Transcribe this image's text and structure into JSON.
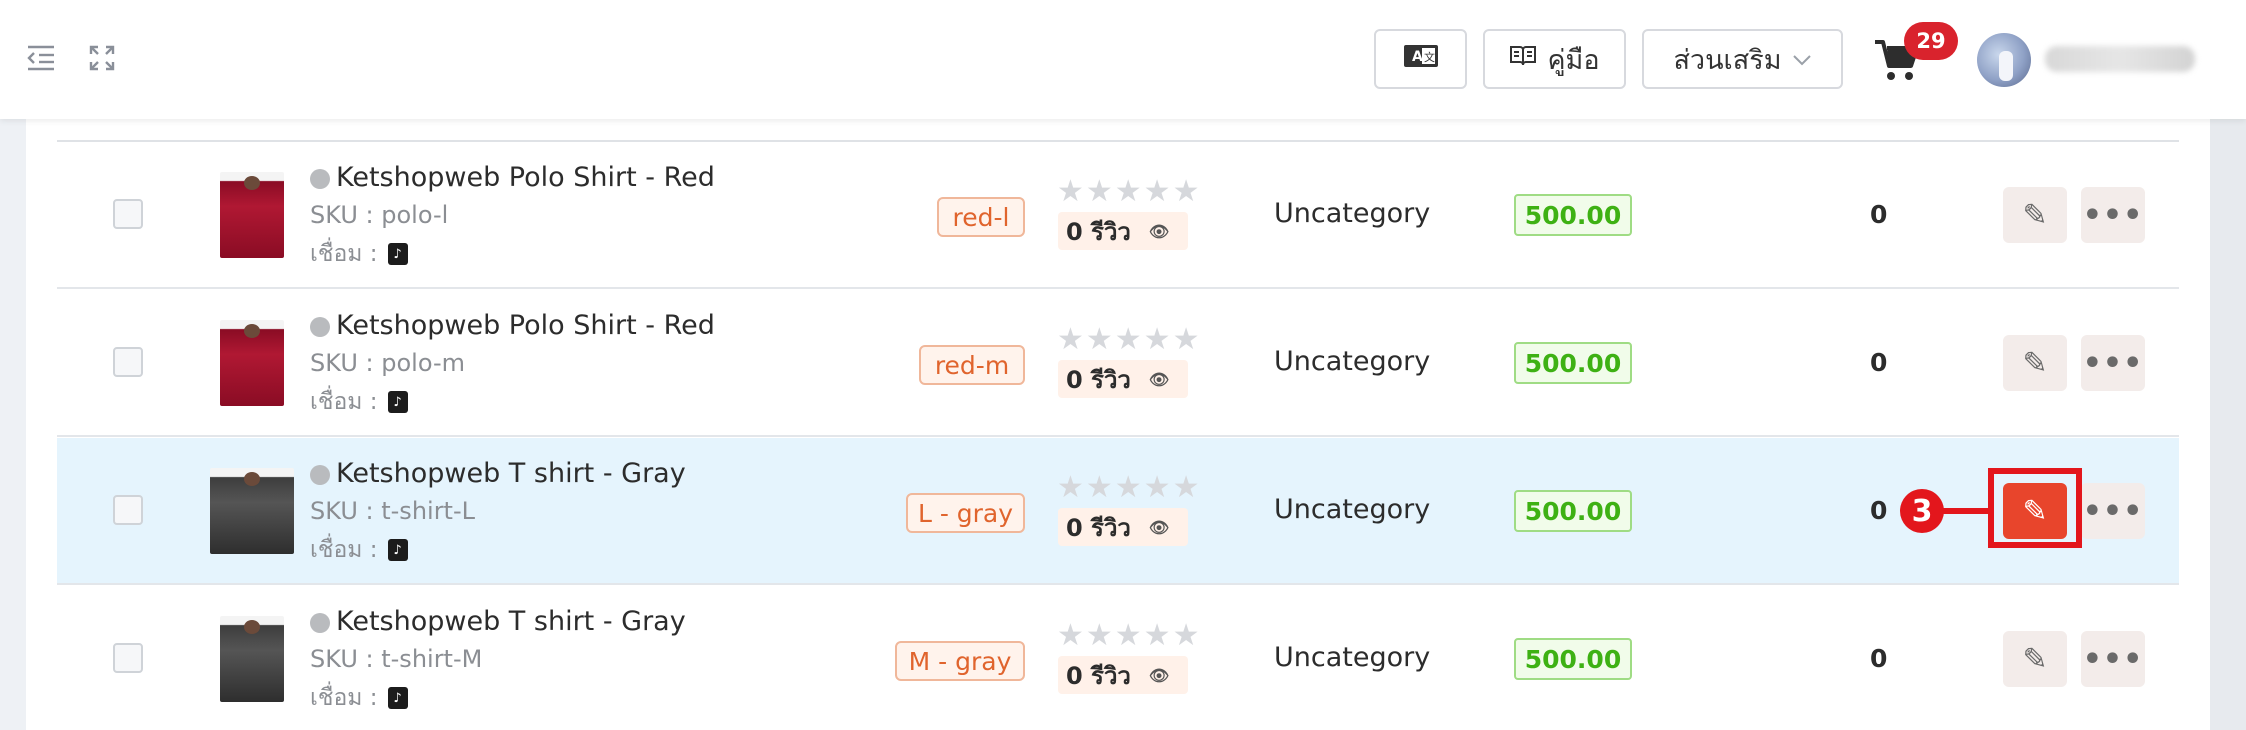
{
  "topbar": {
    "menu_icon": "outdent-menu-icon",
    "expand_icon": "fullscreen-expand-icon",
    "translate_icon": "translate-icon",
    "manual_icon": "book-icon",
    "manual_label": "คู่มือ",
    "addons_label": "ส่วนเสริม",
    "cart_icon": "shopping-cart-icon",
    "cart_count": "29"
  },
  "products": [
    {
      "name": "Ketshopweb Polo Shirt - Red",
      "sku": "SKU : polo-l",
      "link_label": "เชื่อม :",
      "variant": "red-l",
      "reviews": "0 รีวิว",
      "category": "Uncategory",
      "price": "500.00",
      "stock": "0",
      "thumb_color": "red"
    },
    {
      "name": "Ketshopweb Polo Shirt - Red",
      "sku": "SKU : polo-m",
      "link_label": "เชื่อม :",
      "variant": "red-m",
      "reviews": "0 รีวิว",
      "category": "Uncategory",
      "price": "500.00",
      "stock": "0",
      "thumb_color": "red"
    },
    {
      "name": "Ketshopweb T shirt - Gray",
      "sku": "SKU : t-shirt-L",
      "link_label": "เชื่อม :",
      "variant": "L - gray",
      "reviews": "0 รีวิว",
      "category": "Uncategory",
      "price": "500.00",
      "stock": "0",
      "thumb_color": "gray"
    },
    {
      "name": "Ketshopweb T shirt - Gray",
      "sku": "SKU : t-shirt-M",
      "link_label": "เชื่อม :",
      "variant": "M - gray",
      "reviews": "0 รีวิว",
      "category": "Uncategory",
      "price": "500.00",
      "stock": "0",
      "thumb_color": "gray"
    }
  ],
  "callout": {
    "number": "3",
    "color": "#e3161c"
  },
  "colors": {
    "accent": "#e8452c",
    "price_green": "#3eb114",
    "highlight_row": "#e5f4fd",
    "variant_orange": "#e0642d"
  }
}
